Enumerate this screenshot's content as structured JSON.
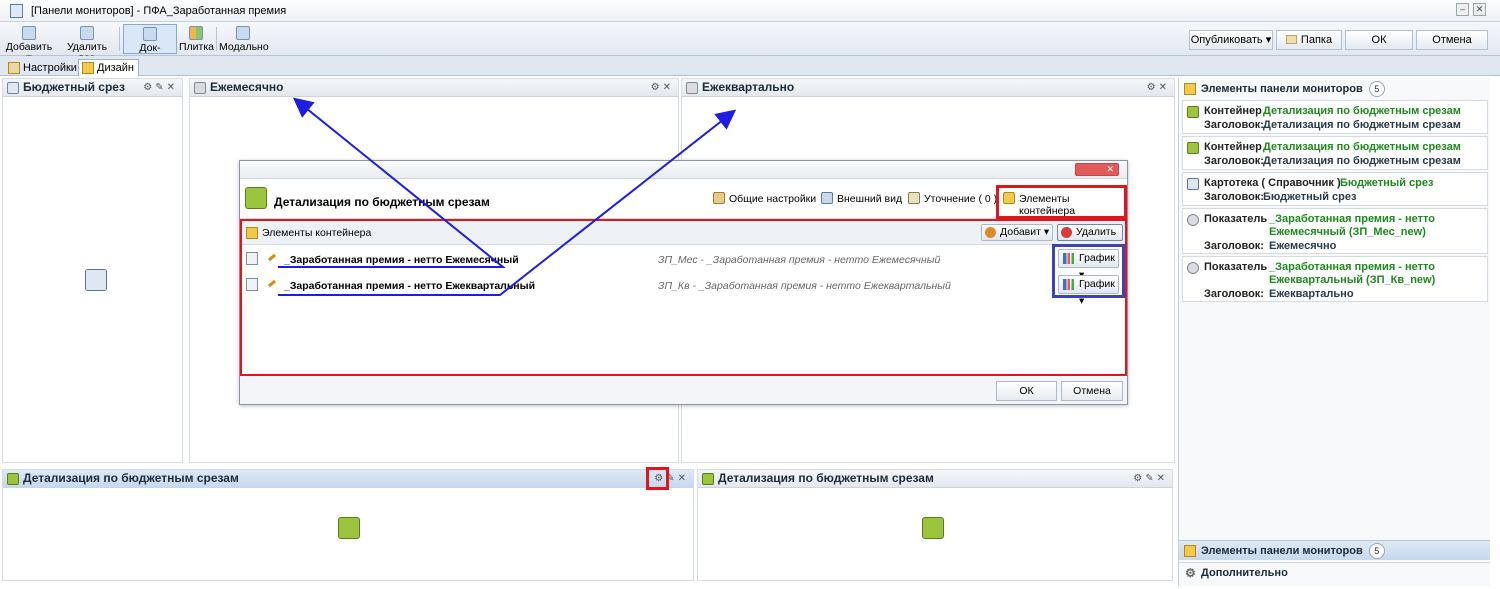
{
  "window": {
    "title": "[Панели мониторов] - ПФА_Заработанная премия"
  },
  "toolbar": {
    "add_label": "Добавить",
    "delete_all_label": "Удалить все",
    "dock_label": "Док-панель",
    "tile_label": "Плитка",
    "modal_label": "Модально",
    "publish_label": "Опубликовать",
    "folder_label": "Папка",
    "ok_label": "ОК",
    "cancel_label": "Отмена"
  },
  "tabs": [
    {
      "label": "Настройки"
    },
    {
      "label": "Дизайн"
    }
  ],
  "panels": {
    "budget_slice": {
      "title": "Бюджетный срез"
    },
    "monthly": {
      "title": "Ежемесячно"
    },
    "quarterly": {
      "title": "Ежеквартально"
    },
    "detail_left": {
      "title": "Детализация по бюджетным срезам"
    },
    "detail_right": {
      "title": "Детализация по бюджетным срезам"
    }
  },
  "dialog": {
    "title": "Детализация по бюджетным срезам",
    "tabs": [
      {
        "label": "Общие настройки"
      },
      {
        "label": "Внешний вид"
      },
      {
        "label": "Уточнение ( 0 )"
      },
      {
        "label": "Элементы контейнера"
      }
    ],
    "section_title": "Элементы контейнера",
    "add_label": "Добавит",
    "delete_label": "Удалить",
    "rows": [
      {
        "name": "_Заработанная премия - нетто Ежемесячный",
        "desc": "ЗП_Мес - _Заработанная премия - нетто Ежемесячный",
        "action": "График"
      },
      {
        "name": "_Заработанная премия - нетто Ежеквартальный",
        "desc": "ЗП_Кв - _Заработанная премия - нетто Ежеквартальный",
        "action": "График"
      }
    ],
    "ok_label": "ОК",
    "cancel_label": "Отмена"
  },
  "right_pane": {
    "header": "Элементы панели мониторов",
    "count": "5",
    "cards": [
      {
        "kind": "Контейнер",
        "value": "Детализация по бюджетным срезам",
        "header_key": "Заголовок:",
        "header": "Детализация по бюджетным срезам"
      },
      {
        "kind": "Контейнер",
        "value": "Детализация по бюджетным срезам",
        "header_key": "Заголовок:",
        "header": "Детализация по бюджетным срезам"
      },
      {
        "kind": "Картотека ( Справочник )",
        "value": "Бюджетный срез",
        "header_key": "Заголовок:",
        "header": "Бюджетный срез"
      },
      {
        "kind": "Показатель",
        "value1": "_Заработанная премия - нетто",
        "value2": "Ежемесячный (ЗП_Мес_new)",
        "header_key": "Заголовок:",
        "header": "Ежемесячно"
      },
      {
        "kind": "Показатель",
        "value1": "_Заработанная премия - нетто",
        "value2": "Ежеквартальный (ЗП_Кв_new)",
        "header_key": "Заголовок:",
        "header": "Ежеквартально"
      }
    ],
    "footer_header": "Элементы панели мониторов",
    "footer_count": "5",
    "extra_label": "Дополнительно"
  }
}
